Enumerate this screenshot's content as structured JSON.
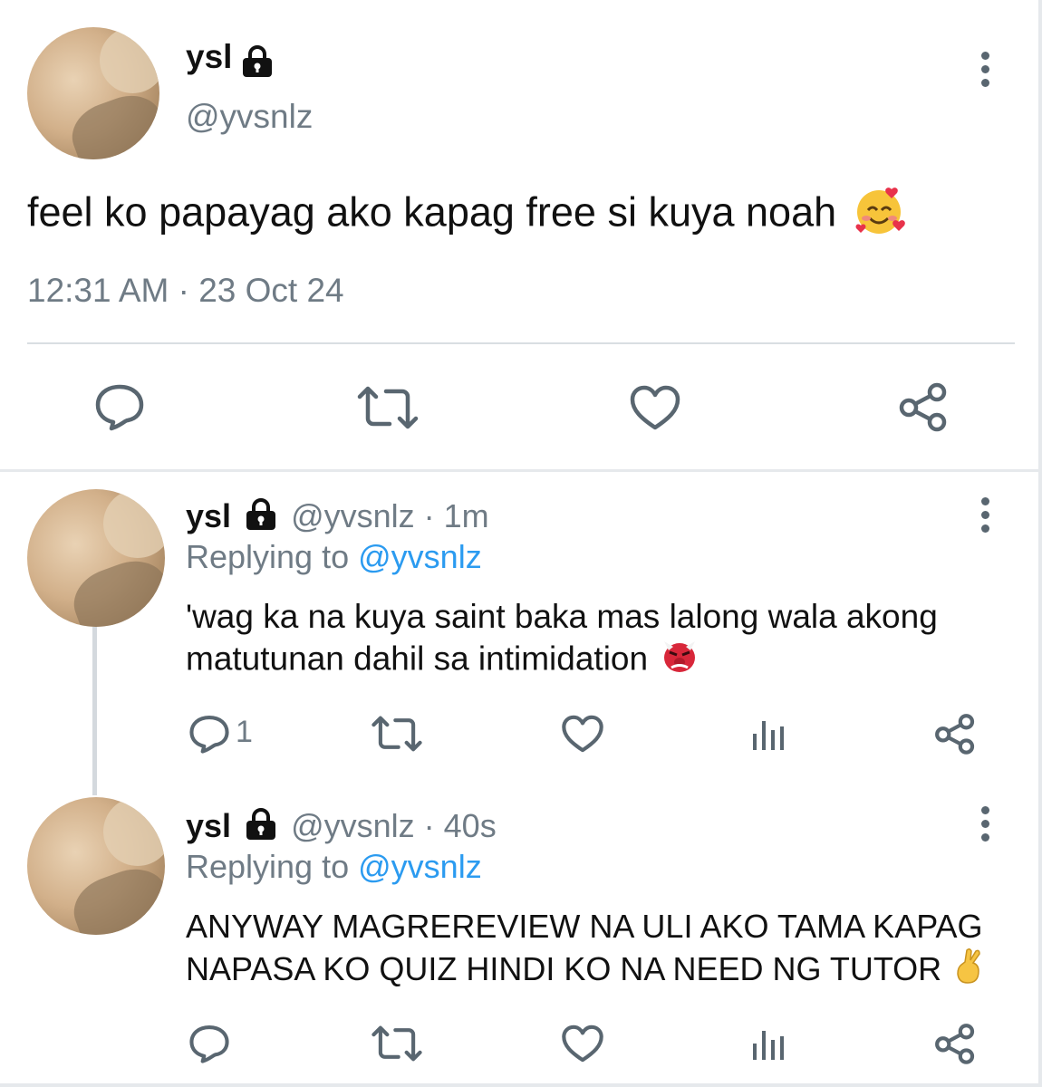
{
  "main_tweet": {
    "display_name": "ysl",
    "handle": "@yvsnlz",
    "text": "feel ko papayag ako kapag free si kuya noah",
    "emoji": "smiling-face-with-hearts",
    "timestamp": "12:31 AM · 23 Oct 24",
    "actions": [
      "reply-icon",
      "retweet-icon",
      "like-icon",
      "share-icon"
    ]
  },
  "replies": [
    {
      "display_name": "ysl",
      "handle": "@yvsnlz",
      "time": "· 1m",
      "replying_to_prefix": "Replying to",
      "replying_to_handle": "@yvsnlz",
      "text_line1": "'wag ka na kuya saint baka mas lalong wala akong",
      "text_line2": "matutunan dahil sa intimidation",
      "emoji": "goblin",
      "reply_count": "1"
    },
    {
      "display_name": "ysl",
      "handle": "@yvsnlz",
      "time": "· 40s",
      "replying_to_prefix": "Replying to",
      "replying_to_handle": "@yvsnlz",
      "text_line1": "ANYWAY MAGREREVIEW NA ULI AKO TAMA KAPAG",
      "text_line2": "NAPASA KO QUIZ HINDI KO NA NEED NG TUTOR",
      "emoji": "crossed-fingers",
      "reply_count": ""
    }
  ],
  "colors": {
    "text": "#111111",
    "muted": "#6f7b85",
    "link": "#2b9bf0",
    "icon": "#596670",
    "divider": "#d9dee2"
  }
}
